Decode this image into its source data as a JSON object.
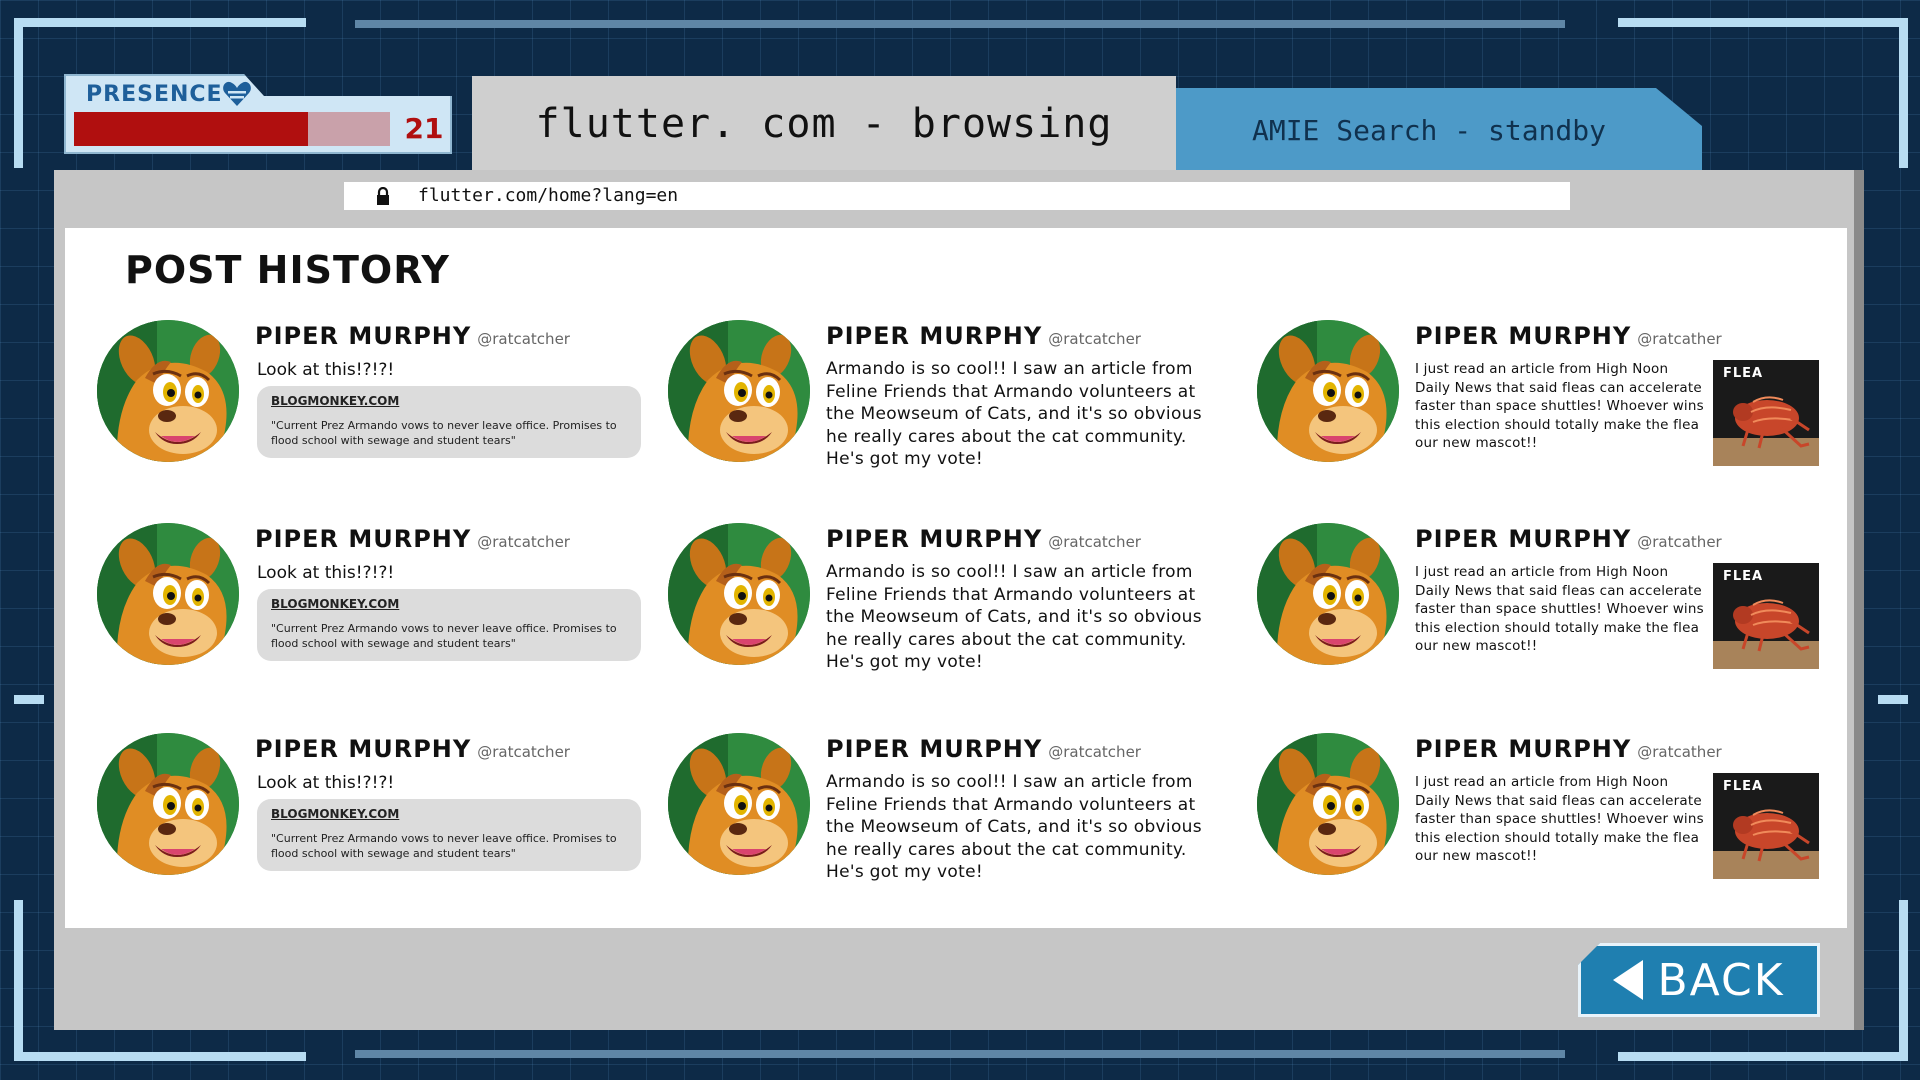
{
  "presence": {
    "label": "PRESENCE",
    "value": 21,
    "value_text": "21",
    "fill_fraction": 0.74,
    "fill_color": "#b00f0f"
  },
  "tabs": {
    "active": "flutter. com - browsing",
    "standby": "AMIE Search - standby"
  },
  "browser": {
    "url": "flutter.com/home?lang=en",
    "lock_icon": "lock-icon"
  },
  "page": {
    "title": "POST HISTORY"
  },
  "posts": [
    {
      "name": "PIPER MURPHY",
      "handle": "@ratcatcher",
      "text": "Look at this!?!?!",
      "link_domain": "BLOGMONKEY.COM",
      "link_desc": "\"Current Prez Armando vows to never leave office. Promises to flood school with sewage and student tears\""
    },
    {
      "name": "PIPER MURPHY",
      "handle": "@ratcatcher",
      "text": "Armando is so cool!! I saw an article from Feline Friends that Armando volunteers at the Meowseum of Cats, and it's so obvious he really cares about the cat community. He's got my vote!"
    },
    {
      "name": "PIPER MURPHY",
      "handle": "@ratcather",
      "text": "I just read an article from High Noon Daily News that said fleas can accelerate faster than space shuttles! Whoever wins this election should totally make the flea our new mascot!!",
      "image_label": "FLEA"
    }
  ],
  "back_button": {
    "label": "BACK",
    "color": "#1f7fb0"
  },
  "colors": {
    "background": "#0d2a47",
    "frame": "#b7dcf2",
    "standby_tab": "#4d9ac8"
  }
}
